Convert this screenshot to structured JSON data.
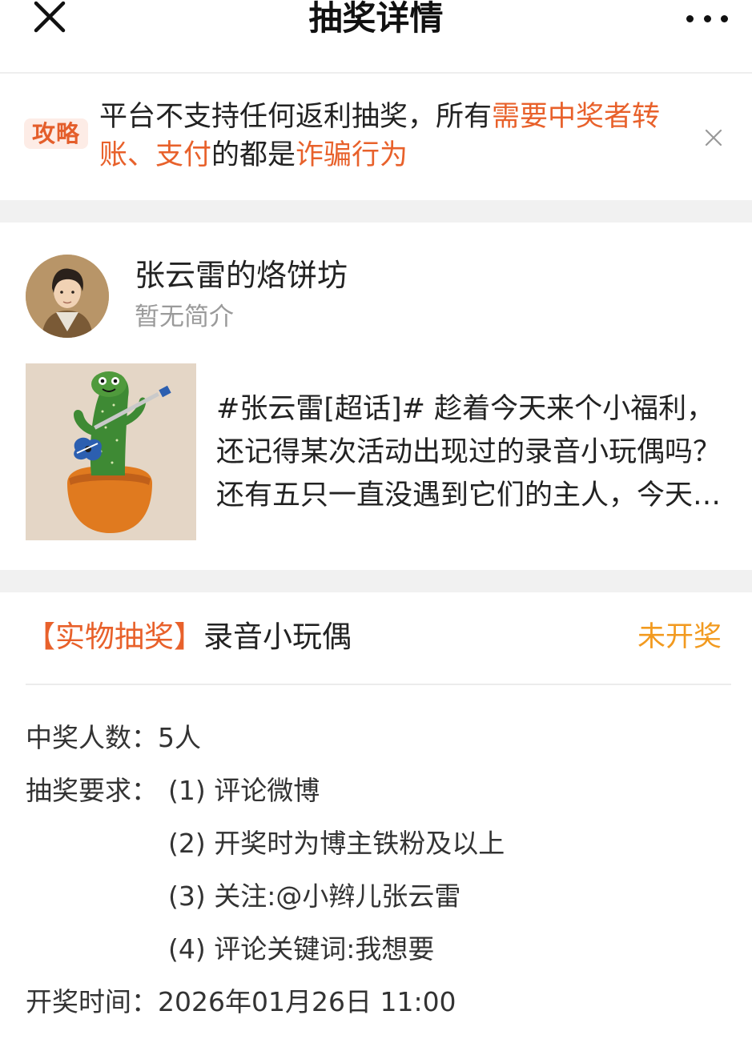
{
  "header": {
    "title": "抽奖详情"
  },
  "notice": {
    "badge": "攻略",
    "text_part1": "平台不支持任何返利抽奖，所有",
    "text_hl1": "需要中奖者转账、支付",
    "text_part2": "的都是",
    "text_hl2": "诈骗行为",
    "highlight_color": "#e8612b"
  },
  "profile": {
    "name": "张云雷的烙饼坊",
    "bio": "暂无简介"
  },
  "post": {
    "text": "#张云雷[超话]# 趁着今天来个小福利，还记得某次活动出现过的录音小玩偶吗？还有五只一直没遇到它们的主人，今天就送给大家吧"
  },
  "lottery": {
    "tag": "【实物抽奖】",
    "prize": "录音小玩偶",
    "status": "未开奖",
    "status_color": "#f29a1f",
    "winners_label": "中奖人数：",
    "winners_value": "5人",
    "requirements_label": "抽奖要求：",
    "requirements": [
      "(1) 评论微博",
      "(2) 开奖时为博主铁粉及以上",
      "(3) 关注:@小辫儿张云雷",
      "(4) 评论关键词:我想要"
    ],
    "time_label": "开奖时间：",
    "time_value": "2026年01月26日 11:00"
  },
  "icons": {
    "close": "close-icon",
    "more": "more-icon",
    "notice_close": "close-icon"
  }
}
